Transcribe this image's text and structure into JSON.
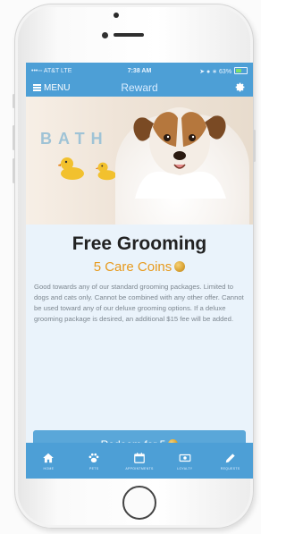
{
  "status_bar": {
    "carrier": "•••◦◦ AT&T  LTE",
    "time": "7:38 AM",
    "battery": "63%"
  },
  "nav": {
    "menu_label": "MENU",
    "title": "Reward"
  },
  "hero": {
    "bath_text": "BATH"
  },
  "reward": {
    "title": "Free Grooming",
    "cost": "5 Care Coins",
    "description": "Good towards any of our standard grooming packages. Limited to dogs and cats only. Cannot be combined with any other offer. Cannot be used toward any of our deluxe grooming options. If a deluxe grooming package is desired, an additional $15 fee will be added.",
    "redeem_label": "Redeem for 5"
  },
  "tabs": [
    {
      "label": "HOME",
      "icon": "home-icon"
    },
    {
      "label": "PETS",
      "icon": "paw-icon"
    },
    {
      "label": "APPOINTMENTS",
      "icon": "calendar-icon"
    },
    {
      "label": "LOYALTY",
      "icon": "ticket-icon"
    },
    {
      "label": "REQUESTS",
      "icon": "pencil-icon"
    }
  ],
  "colors": {
    "brand_blue": "#4d9fd6",
    "button_blue": "#5aa7d9",
    "coin_orange": "#e79a1d",
    "content_bg": "#eaf3fb"
  }
}
